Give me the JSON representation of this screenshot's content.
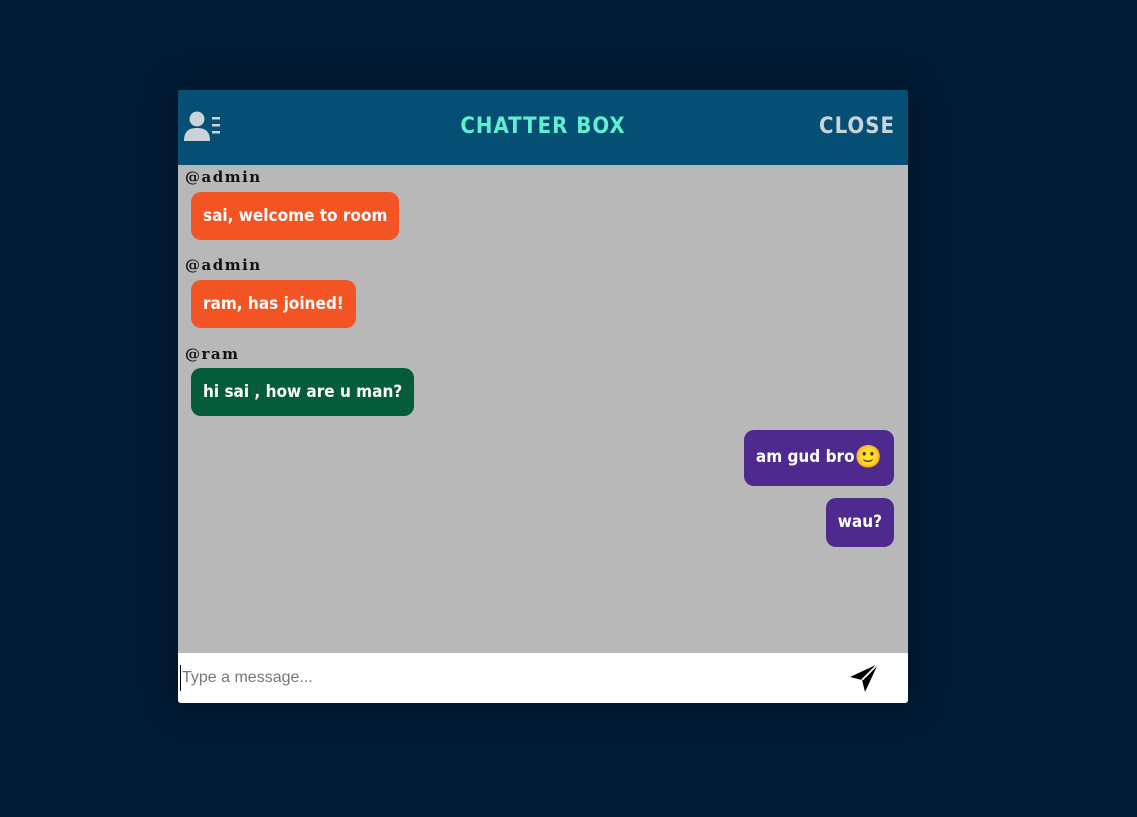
{
  "header": {
    "title": "CHATTER BOX",
    "close_label": "CLOSE",
    "users_icon": "users-list-icon"
  },
  "messages": [
    {
      "sender": "@admin",
      "text": "sai, welcome to room",
      "type": "admin",
      "mine": false
    },
    {
      "sender": "@admin",
      "text": "ram, has joined!",
      "type": "admin",
      "mine": false
    },
    {
      "sender": "@ram",
      "text": "hi sai , how are u man?",
      "type": "other",
      "mine": false
    },
    {
      "sender": "",
      "text": "am gud bro",
      "emoji": "🙂",
      "type": "mine",
      "mine": true
    },
    {
      "sender": "",
      "text": "wau?",
      "type": "mine",
      "mine": true
    }
  ],
  "input": {
    "placeholder": "Type a message...",
    "value": ""
  },
  "send_icon": "send-icon",
  "colors": {
    "background": "#001c36",
    "header": "#054f75",
    "title": "#5ff0cf",
    "chat_area": "#b8b8b8",
    "admin_bubble": "#f25424",
    "other_bubble": "#045c3a",
    "mine_bubble": "#4e2a8e"
  }
}
